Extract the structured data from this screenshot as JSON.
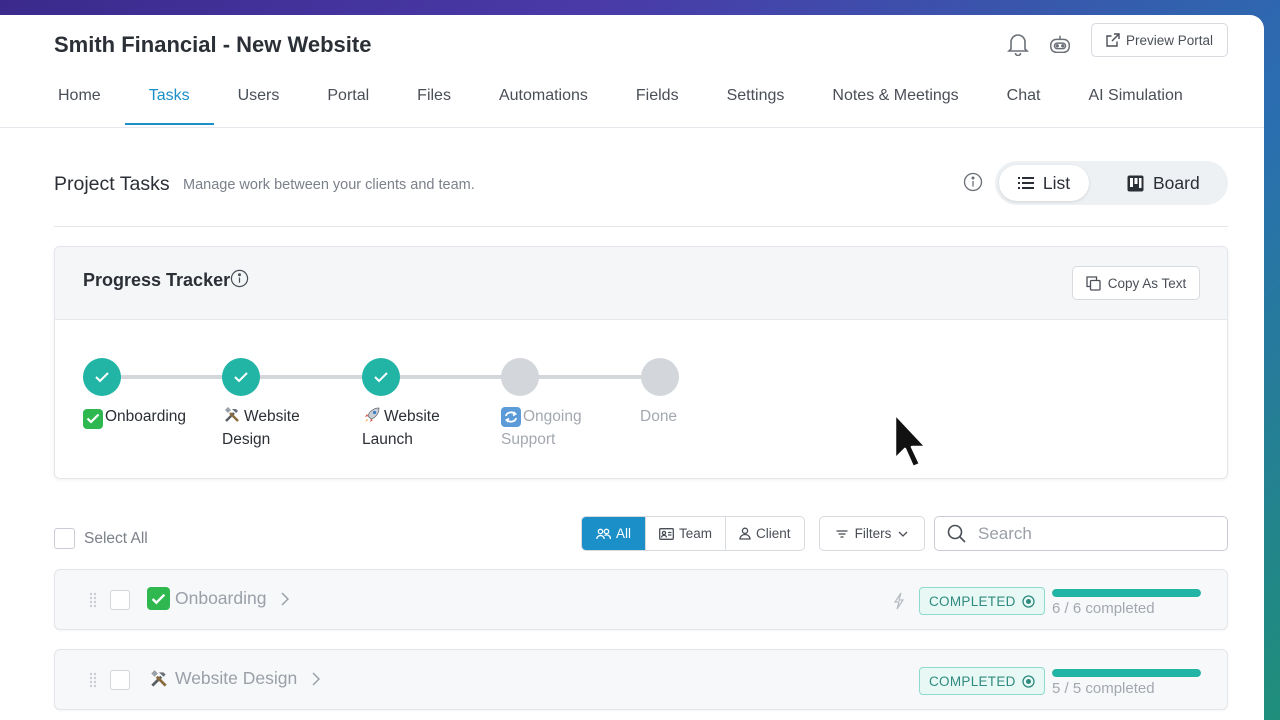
{
  "header": {
    "title": "Smith Financial - New Website",
    "preview_label": "Preview Portal"
  },
  "tabs": [
    {
      "label": "Home"
    },
    {
      "label": "Tasks",
      "active": true
    },
    {
      "label": "Users"
    },
    {
      "label": "Portal"
    },
    {
      "label": "Files"
    },
    {
      "label": "Automations"
    },
    {
      "label": "Fields"
    },
    {
      "label": "Settings"
    },
    {
      "label": "Notes & Meetings"
    },
    {
      "label": "Chat"
    },
    {
      "label": "AI Simulation"
    }
  ],
  "section": {
    "title": "Project Tasks",
    "subtitle": "Manage work between your clients and team.",
    "view_list": "List",
    "view_board": "Board"
  },
  "tracker": {
    "title": "Progress Tracker",
    "copy_label": "Copy As Text",
    "steps": [
      {
        "emoji": "✅",
        "line1": "Onboarding",
        "line2": "",
        "done": true
      },
      {
        "emoji": "🛠",
        "line1": "Website",
        "line2": "Design",
        "done": true
      },
      {
        "emoji": "🚀",
        "line1": "Website",
        "line2": "Launch",
        "done": true
      },
      {
        "emoji": "🔄",
        "line1": "Ongoing",
        "line2": "Support",
        "done": false
      },
      {
        "emoji": "",
        "line1": "Done",
        "line2": "",
        "done": false
      }
    ]
  },
  "toolbar": {
    "select_all": "Select All",
    "seg_all": "All",
    "seg_team": "Team",
    "seg_client": "Client",
    "filters": "Filters",
    "search_placeholder": "Search"
  },
  "tasks": [
    {
      "emoji": "✅",
      "name": "Onboarding",
      "status": "COMPLETED",
      "progress_text": "6 / 6 completed",
      "progress": 1.0
    },
    {
      "emoji": "🛠",
      "name": "Website Design",
      "status": "COMPLETED",
      "progress_text": "5 / 5 completed",
      "progress": 1.0
    }
  ],
  "colors": {
    "accent": "#1a8fc8",
    "success": "#22b5a6",
    "pending": "#d3d6db"
  }
}
